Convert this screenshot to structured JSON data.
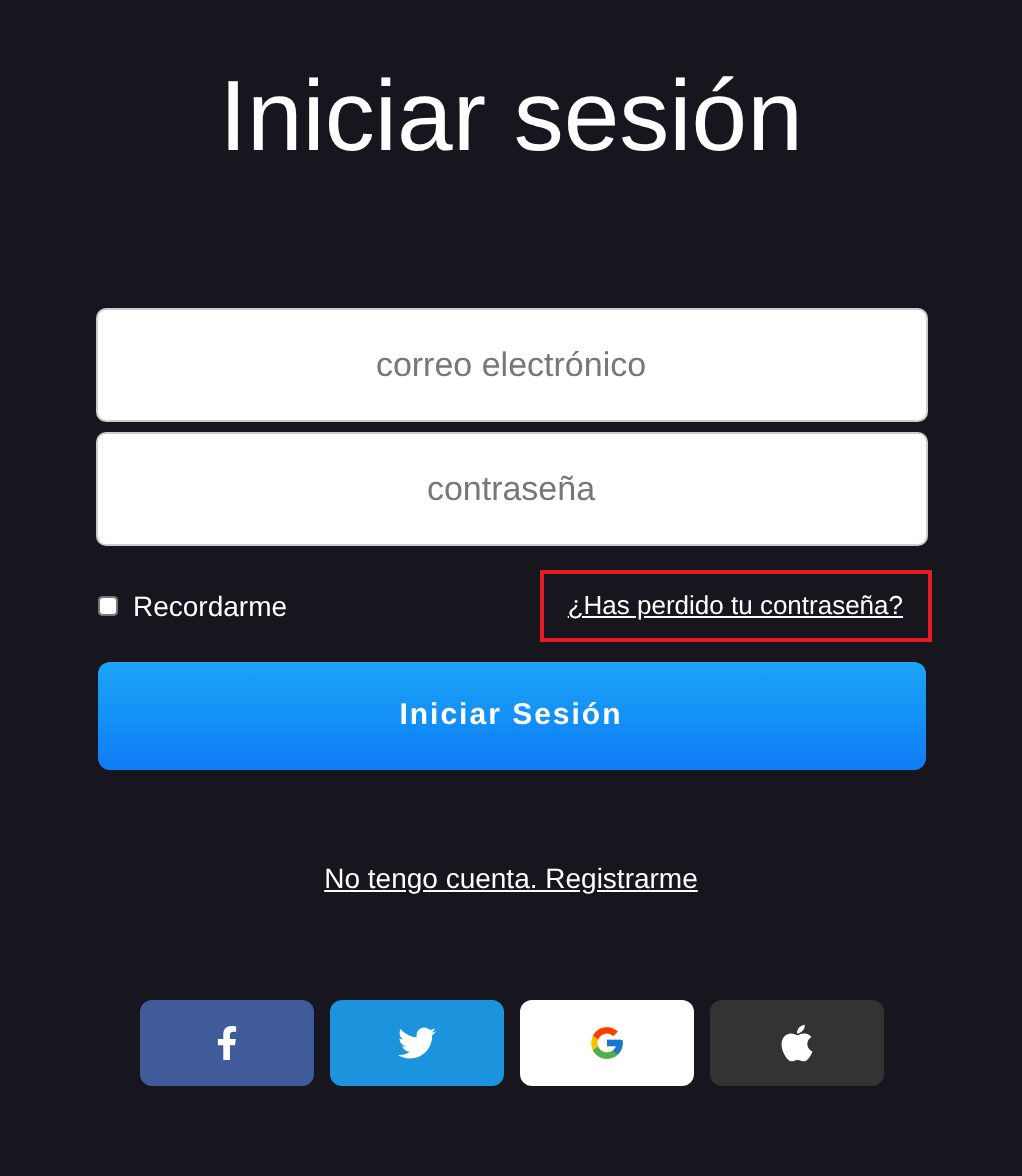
{
  "title": "Iniciar sesión",
  "fields": [
    {
      "placeholder": "correo electrónico"
    },
    {
      "placeholder": "contraseña"
    }
  ],
  "remember": {
    "label": "Recordarme",
    "checked": false
  },
  "forgot_link": {
    "label": "¿Has perdido tu contraseña?",
    "highlighted": true
  },
  "submit_button": "Iniciar Sesión",
  "register_link": "No tengo cuenta. Registrarme",
  "social_buttons": [
    {
      "kind": "facebook"
    },
    {
      "kind": "twitter"
    },
    {
      "kind": "google"
    },
    {
      "kind": "apple"
    }
  ]
}
